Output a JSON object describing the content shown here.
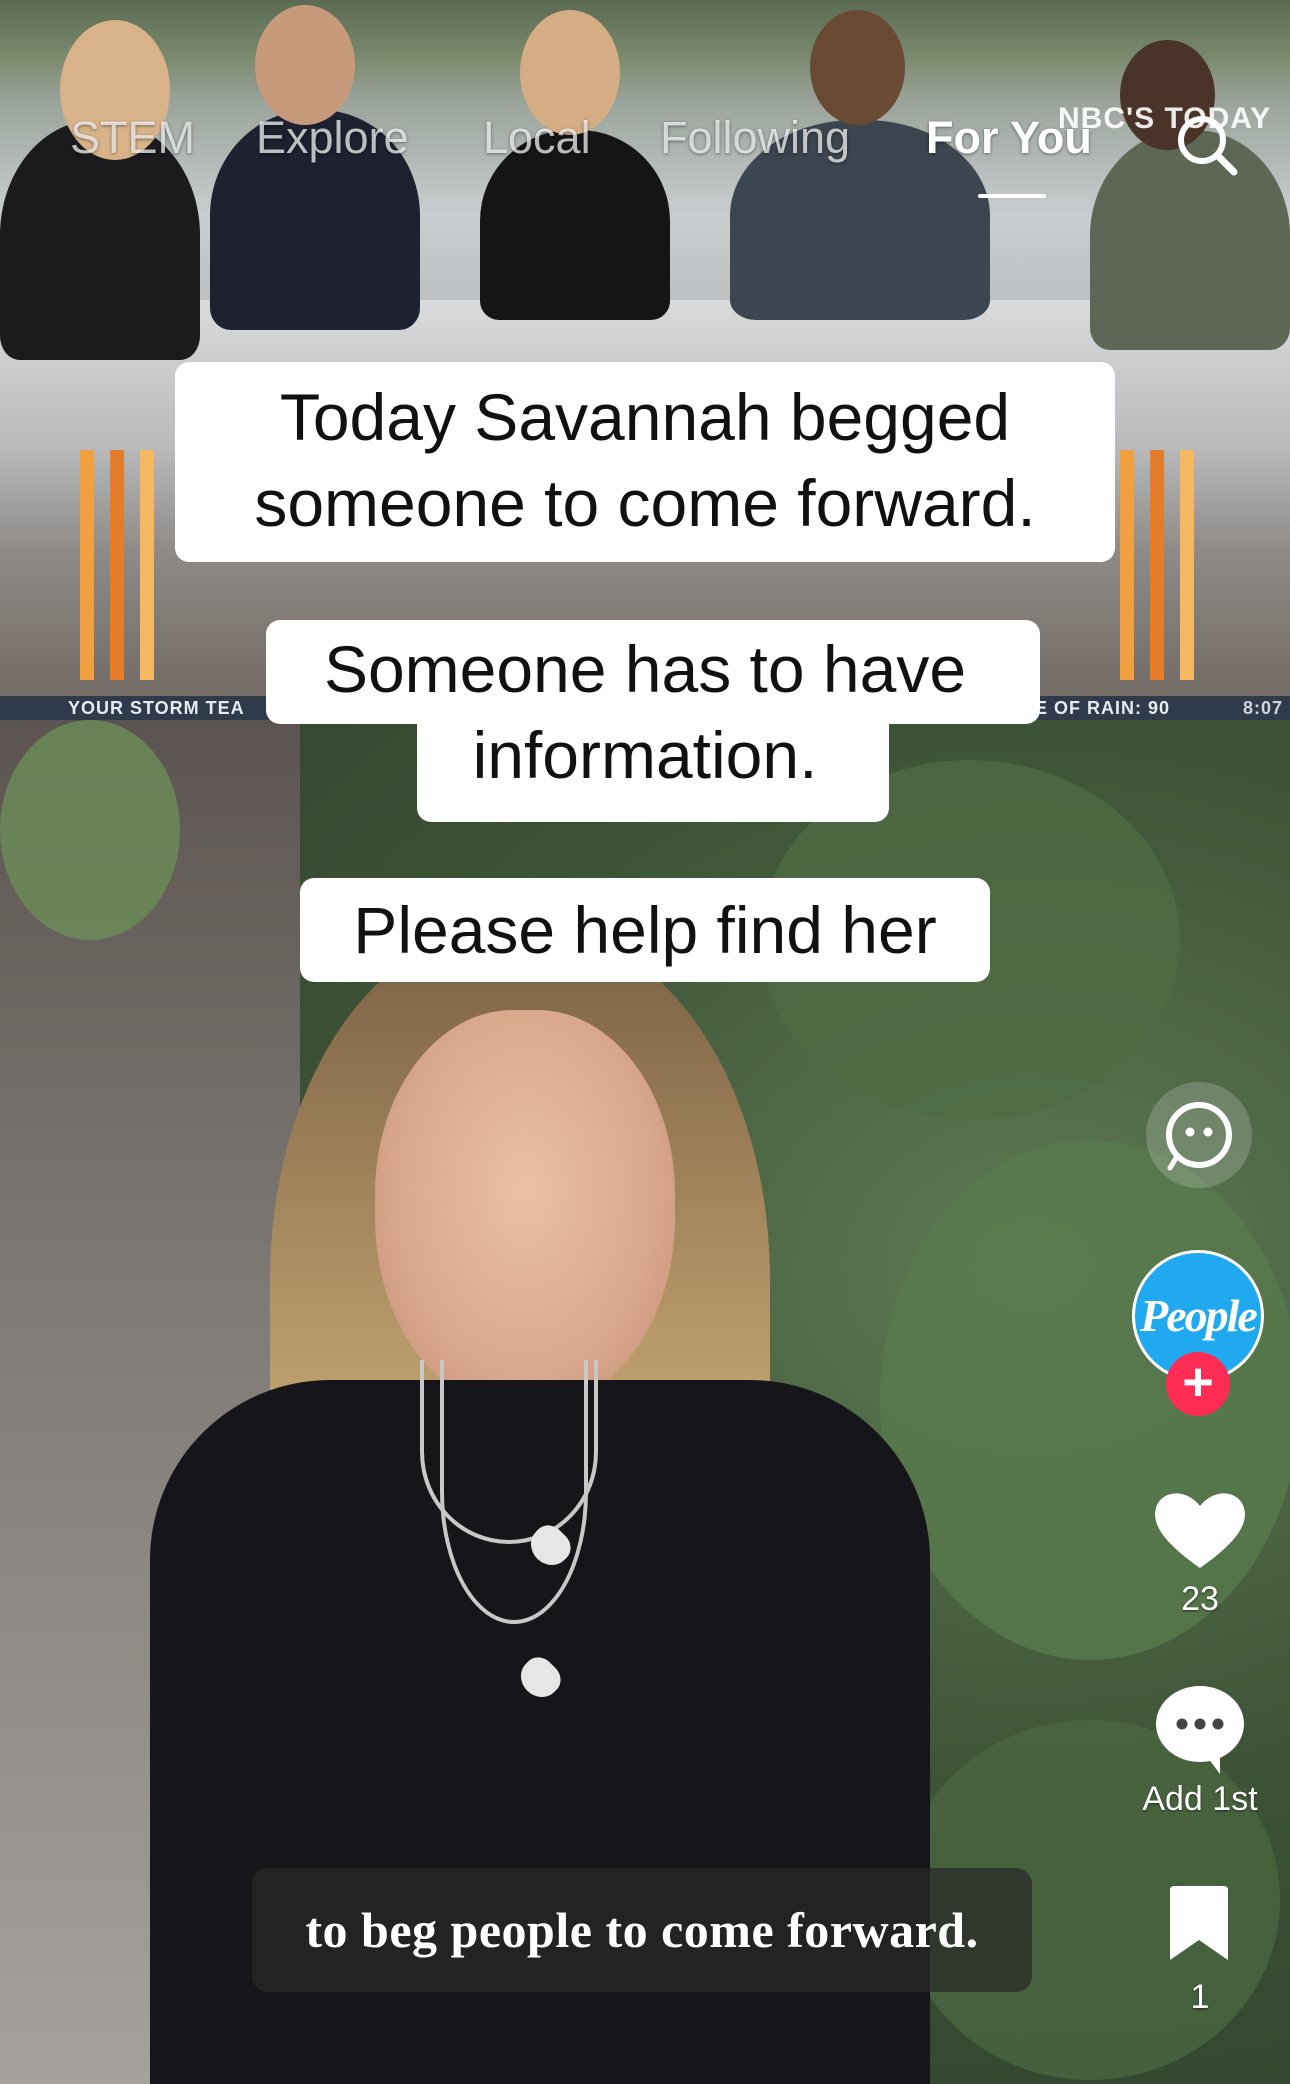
{
  "nav": {
    "tabs": [
      {
        "label": "STEM"
      },
      {
        "label": "Explore"
      },
      {
        "label": "Local"
      },
      {
        "label": "Following"
      },
      {
        "label": "For You",
        "active": true
      }
    ],
    "search_icon": "search-icon"
  },
  "video": {
    "overlay_brand": "NBC'S TODAY",
    "ticker_left": "YOUR STORM TEA",
    "ticker_right": "E OF RAIN: 90",
    "ticker_time": "8:07",
    "captions": [
      "Today Savannah begged someone to come forward.",
      "Someone has to have information.",
      "Please help find her"
    ],
    "subtitle": "to beg people to come forward."
  },
  "rail": {
    "creator_avatar_text": "People",
    "like_count": "23",
    "comment_label": "Add 1st",
    "bookmark_count": "1"
  },
  "colors": {
    "accent_follow": "#fe2c55",
    "avatar_bg": "#21a9f0"
  }
}
